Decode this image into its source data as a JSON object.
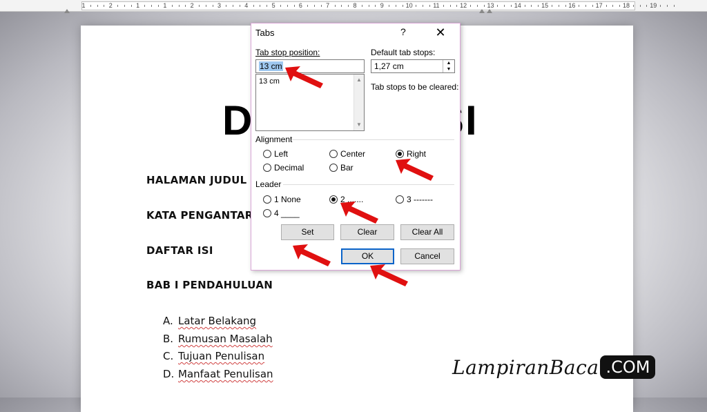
{
  "ruler": {
    "numbers": [
      "1",
      "2",
      "1",
      "1",
      "2",
      "3",
      "4",
      "5",
      "6",
      "7",
      "8",
      "9",
      "10",
      "11",
      "12",
      "13",
      "14",
      "15",
      "16",
      "17",
      "18",
      "19"
    ]
  },
  "document": {
    "title_left": "D",
    "title_right": "SI",
    "headings": [
      "HALAMAN JUDUL",
      "KATA PENGANTAR",
      "DAFTAR ISI",
      "BAB I PENDAHULUAN"
    ],
    "subitems": [
      {
        "num": "A.",
        "text": "Latar Belakang"
      },
      {
        "num": "B.",
        "text": "Rumusan Masalah"
      },
      {
        "num": "C.",
        "text": "Tujuan Penulisan"
      },
      {
        "num": "D.",
        "text": "Manfaat Penulisan"
      }
    ]
  },
  "dialog": {
    "title": "Tabs",
    "help": "?",
    "close": "✕",
    "tab_stop_position_label": "Tab stop position:",
    "tab_stop_position_value": "13 cm",
    "tab_stop_list": [
      "13 cm"
    ],
    "default_tab_stops_label": "Default tab stops:",
    "default_tab_stops_value": "1,27 cm",
    "tab_stops_cleared_label": "Tab stops to be cleared:",
    "alignment_label": "Alignment",
    "alignment_options": [
      {
        "label": "Left",
        "checked": false
      },
      {
        "label": "Center",
        "checked": false
      },
      {
        "label": "Right",
        "checked": true
      },
      {
        "label": "Decimal",
        "checked": false
      },
      {
        "label": "Bar",
        "checked": false
      }
    ],
    "leader_label": "Leader",
    "leader_options": [
      {
        "label": "1 None",
        "checked": false
      },
      {
        "label": "2 .......",
        "checked": true
      },
      {
        "label": "3 -------",
        "checked": false
      },
      {
        "label": "4 ____",
        "checked": false
      }
    ],
    "buttons": {
      "set": "Set",
      "clear": "Clear",
      "clear_all": "Clear All",
      "ok": "OK",
      "cancel": "Cancel"
    }
  },
  "watermark": {
    "script": "LampiranBaca",
    "com": ".COM"
  },
  "colors": {
    "arrow_red": "#e01010",
    "selection_blue": "#9fc8f0",
    "dialog_border": "#d9a4d6"
  }
}
